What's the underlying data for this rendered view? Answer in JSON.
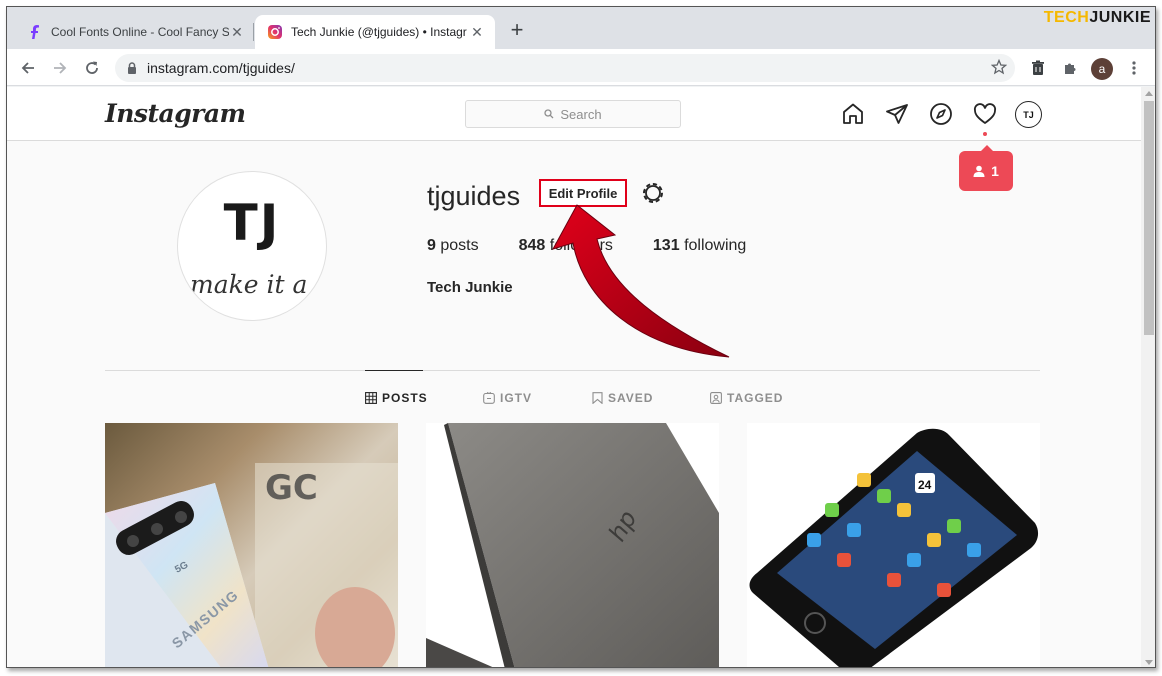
{
  "browser": {
    "tabs": [
      {
        "title": "Cool Fonts Online - Cool Fancy St",
        "active": false
      },
      {
        "title": "Tech Junkie (@tjguides) • Instagr",
        "active": true
      }
    ],
    "url": "instagram.com/tjguides/",
    "profile_initial": "a",
    "brand_part1": "TECH",
    "brand_part2": "JUNKIE"
  },
  "instagram": {
    "logo": "Instagram",
    "search_placeholder": "Search",
    "nav_profile_initials": "TJ",
    "notification_count": "1"
  },
  "profile": {
    "avatar_initials": "TJ",
    "avatar_tagline": "make it a",
    "username": "tjguides",
    "edit_button": "Edit Profile",
    "posts_count": "9",
    "posts_label": "posts",
    "followers_count": "848",
    "followers_label": "followers",
    "following_count": "131",
    "following_label": "following",
    "full_name": "Tech Junkie"
  },
  "profile_tabs": [
    {
      "label": "POSTS",
      "icon": "grid-icon",
      "active": true
    },
    {
      "label": "IGTV",
      "icon": "igtv-icon",
      "active": false
    },
    {
      "label": "SAVED",
      "icon": "bookmark-icon",
      "active": false
    },
    {
      "label": "TAGGED",
      "icon": "tagged-icon",
      "active": false
    }
  ],
  "posts": [
    {
      "subject": "samsung-phone",
      "text": "SAMSUNG"
    },
    {
      "subject": "hp-laptop"
    },
    {
      "subject": "iphone"
    }
  ],
  "colors": {
    "annotation_red": "#e0001a",
    "notification_red": "#ed4956"
  }
}
